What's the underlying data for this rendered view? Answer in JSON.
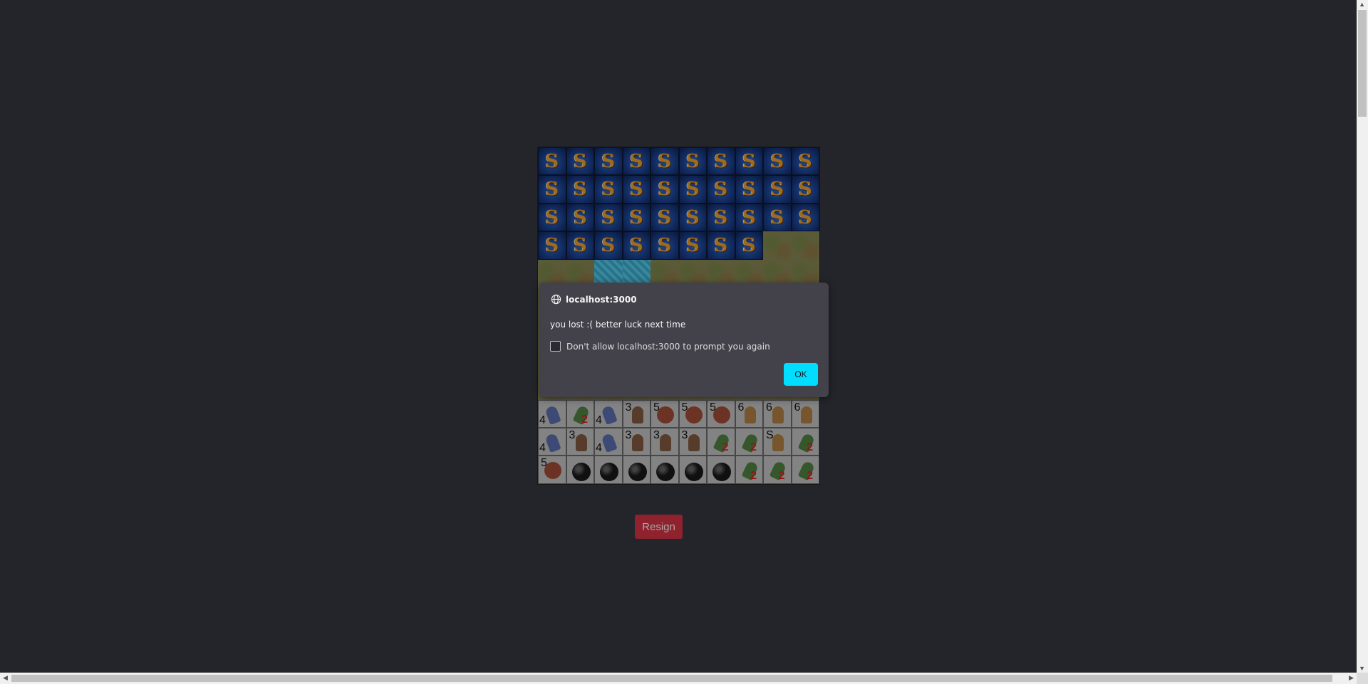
{
  "board": {
    "rows": [
      [
        "S",
        "S",
        "S",
        "S",
        "S",
        "S",
        "S",
        "S",
        "S",
        "S"
      ],
      [
        "S",
        "S",
        "S",
        "S",
        "S",
        "S",
        "S",
        "S",
        "S",
        "S"
      ],
      [
        "S",
        "S",
        "S",
        "S",
        "S",
        "S",
        "S",
        "S",
        "S",
        "S"
      ],
      [
        "S",
        "S",
        "S",
        "S",
        "S",
        "S",
        "S",
        "S",
        "grass",
        "grass"
      ],
      [
        "grass",
        "grass",
        "water",
        "water",
        "grass",
        "grass",
        "grass",
        "grass",
        "grass",
        "grass"
      ]
    ],
    "enemy_glyph": "S",
    "player_rows": [
      [
        {
          "r": "4",
          "k": "bird"
        },
        {
          "r": "",
          "k": "leaf",
          "red": "2"
        },
        {
          "r": "4",
          "k": "bird"
        },
        {
          "r": "3",
          "k": "fig"
        },
        {
          "r": "5",
          "k": "beast"
        },
        {
          "r": "5",
          "k": "beast"
        },
        {
          "r": "5",
          "k": "beast"
        },
        {
          "r": "6",
          "k": "cat"
        },
        {
          "r": "6",
          "k": "cat"
        },
        {
          "r": "6",
          "k": "cat"
        }
      ],
      [
        {
          "r": "4",
          "k": "bird"
        },
        {
          "r": "3",
          "k": "fig"
        },
        {
          "r": "4",
          "k": "bird"
        },
        {
          "r": "3",
          "k": "fig"
        },
        {
          "r": "3",
          "k": "fig"
        },
        {
          "r": "3",
          "k": "fig"
        },
        {
          "r": "",
          "k": "leaf",
          "red": "2"
        },
        {
          "r": "",
          "k": "leaf",
          "red": "2"
        },
        {
          "r": "S",
          "k": "cat"
        },
        {
          "r": "",
          "k": "leaf",
          "red": "2"
        }
      ],
      [
        {
          "r": "5",
          "k": "beast"
        },
        {
          "r": "",
          "k": "bomb"
        },
        {
          "r": "",
          "k": "bomb"
        },
        {
          "r": "",
          "k": "bomb"
        },
        {
          "r": "",
          "k": "bomb"
        },
        {
          "r": "",
          "k": "bomb"
        },
        {
          "r": "",
          "k": "bomb"
        },
        {
          "r": "",
          "k": "leaf",
          "red": "2"
        },
        {
          "r": "",
          "k": "leaf",
          "red": "2"
        },
        {
          "r": "",
          "k": "leaf",
          "red": "2"
        }
      ]
    ]
  },
  "resign_label": "Resign",
  "dialog": {
    "origin": "localhost:3000",
    "message": "you lost :( better luck next time",
    "checkbox_label": "Don't allow localhost:3000 to prompt you again",
    "ok_label": "OK"
  }
}
